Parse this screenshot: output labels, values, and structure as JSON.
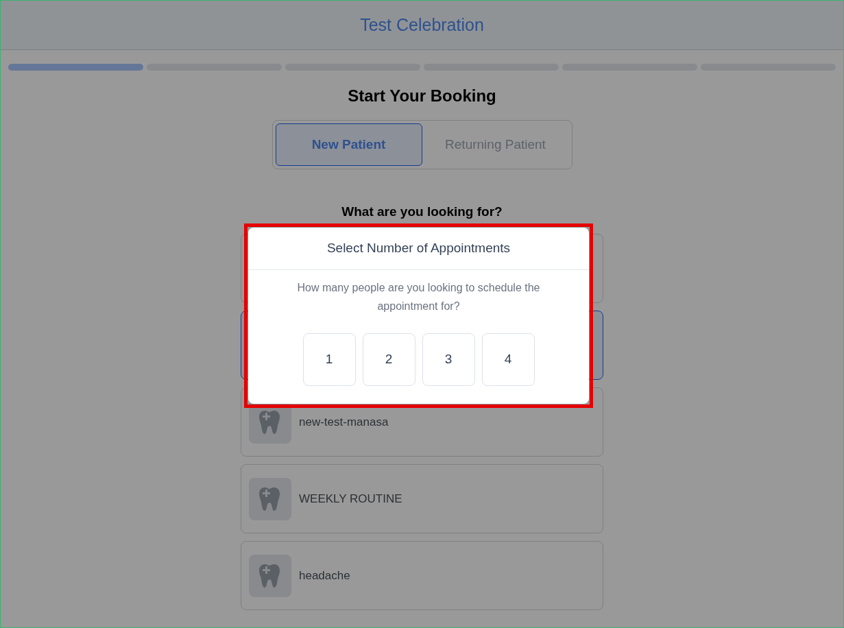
{
  "header": {
    "title": "Test Celebration"
  },
  "progress": {
    "steps": [
      {
        "completed": true
      },
      {
        "completed": false
      },
      {
        "completed": false
      },
      {
        "completed": false
      },
      {
        "completed": false
      },
      {
        "completed": false
      }
    ]
  },
  "heading": "Start Your Booking",
  "patient_tabs": [
    {
      "label": "New Patient",
      "selected": true
    },
    {
      "label": "Returning Patient",
      "selected": false
    }
  ],
  "services": {
    "question": "What are you looking for?",
    "items": [
      {
        "selected": false
      },
      {
        "selected": true
      },
      {
        "label": "new-test-manasa",
        "selected": false
      },
      {
        "label": "WEEKLY ROUTINE",
        "selected": false
      },
      {
        "label": "headache",
        "selected": false
      }
    ]
  },
  "modal": {
    "title": "Select Number of Appointments",
    "message": "How many people are you looking to schedule the appointment for?",
    "highlighted": true,
    "options": [
      {
        "label": "1"
      },
      {
        "label": "2"
      },
      {
        "label": "3"
      },
      {
        "label": "4"
      }
    ]
  }
}
